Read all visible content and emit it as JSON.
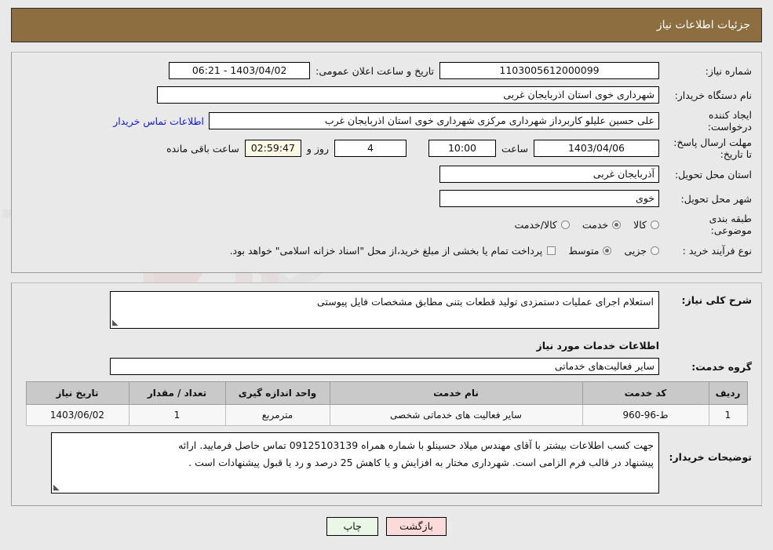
{
  "header": {
    "title": "جزئیات اطلاعات نیاز"
  },
  "form": {
    "need_number_label": "شماره نیاز:",
    "need_number_value": "1103005612000099",
    "announce_label": "تاریخ و ساعت اعلان عمومی:",
    "announce_value": "1403/04/02 - 06:21",
    "buyer_org_label": "نام دستگاه خریدار:",
    "buyer_org_value": "شهرداری خوی استان اذربایجان غربی",
    "creator_label": "ایجاد کننده درخواست:",
    "creator_value": "علی حسین علیلو کاربرداز شهرداری مرکزی شهرداری خوی استان اذربایجان غرب",
    "contact_link": "اطلاعات تماس خریدار",
    "deadline_label": "مهلت ارسال پاسخ: تا تاریخ:",
    "deadline_date": "1403/04/06",
    "hour_label": "ساعت",
    "deadline_time": "10:00",
    "days_value": "4",
    "days_label": "روز و",
    "countdown_value": "02:59:47",
    "remaining_label": "ساعت باقی مانده",
    "province_label": "استان محل تحویل:",
    "province_value": "آذربایجان غربی",
    "city_label": "شهر محل تحویل:",
    "city_value": "خوی",
    "category_label": "طبقه بندی موضوعی:",
    "category_options": [
      {
        "label": "کالا",
        "selected": false
      },
      {
        "label": "خدمت",
        "selected": true
      },
      {
        "label": "کالا/خدمت",
        "selected": false
      }
    ],
    "process_label": "نوع فرآیند خرید :",
    "process_options": [
      {
        "label": "جزیی",
        "selected": false
      },
      {
        "label": "متوسط",
        "selected": true
      }
    ],
    "treasury_note": "پرداخت تمام یا بخشی از مبلغ خرید،از محل \"اسناد خزانه اسلامی\" خواهد بود.",
    "treasury_checked": false
  },
  "description": {
    "label": "شرح کلی نیاز:",
    "value": "استعلام اجرای عملیات دستمزدی تولید قطعات بتنی مطابق مشخصات فایل پیوستی"
  },
  "services": {
    "section_title": "اطلاعات خدمات مورد نیاز",
    "group_label": "گروه خدمت:",
    "group_value": "سایر فعالیت‌های خدماتی",
    "table": {
      "columns": [
        "ردیف",
        "کد خدمت",
        "نام خدمت",
        "واحد اندازه گیری",
        "تعداد / مقدار",
        "تاریخ نیاز"
      ],
      "rows": [
        {
          "index": "1",
          "code": "ط-96-960",
          "name": "سایر فعالیت های خدماتی شخصی",
          "unit": "مترمربع",
          "quantity": "1",
          "need_date": "1403/06/02"
        }
      ]
    }
  },
  "buyer_comments": {
    "label": "توضیحات خریدار:",
    "line1": "جهت کسب اطلاعات بیشتر با آقای مهندس میلاد حسینلو با شماره همراه 09125103139 تماس حاصل فرمایید. ارائه",
    "line2": "پیشنهاد در قالب فرم الزامی است. شهرداری مختار به افزایش و یا کاهش 25 درصد و رد یا قبول پیشنهادات است ."
  },
  "footer": {
    "print_label": "چاپ",
    "back_label": "بازگشت"
  },
  "watermark": {
    "text": "AriaTender.net"
  },
  "colors": {
    "header_bg": "#8d6e41",
    "link": "#1018d8",
    "print_bg": "#eaf7e7",
    "back_bg": "#fbdada",
    "countdown_bg": "#fbf8e3"
  }
}
